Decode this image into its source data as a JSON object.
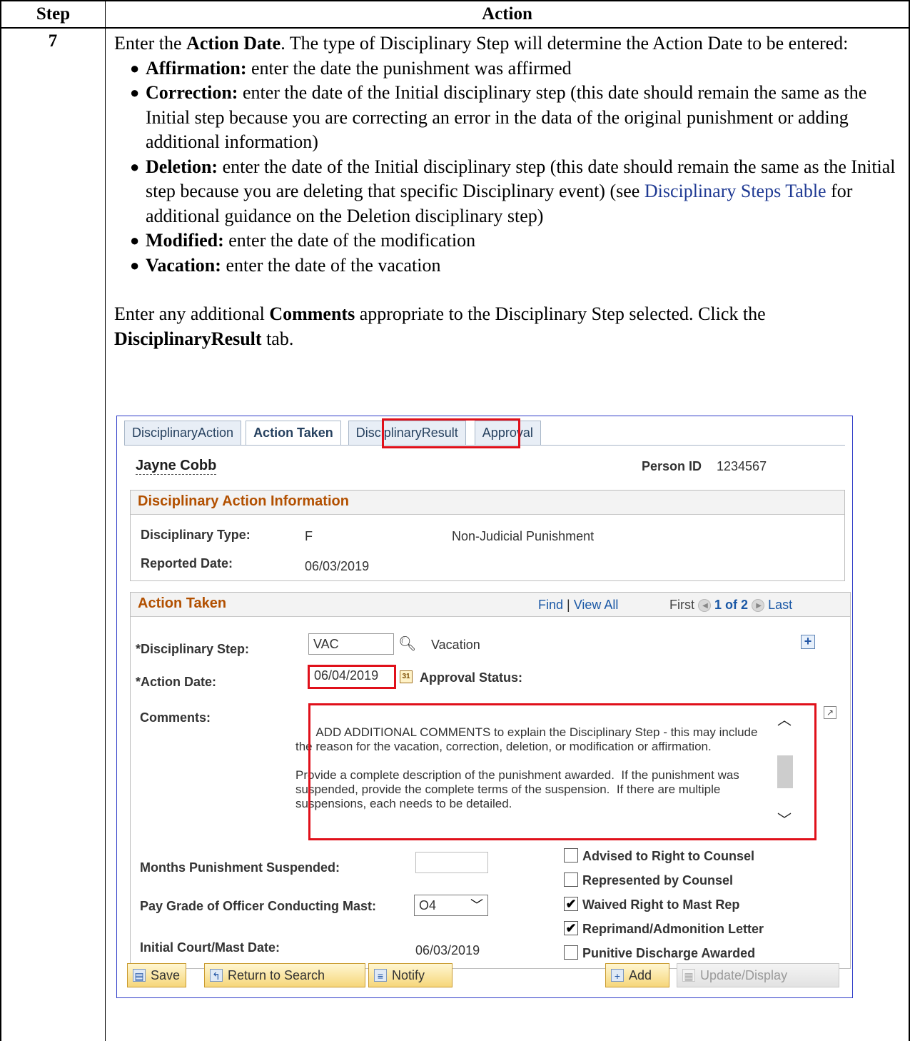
{
  "doc": {
    "header_step": "Step",
    "header_action": "Action",
    "step_number": "7",
    "intro_bold": "Action Date",
    "intro_pre": "Enter the ",
    "intro_post": ".  The type of Disciplinary Step will determine the Action Date to be entered:",
    "bullets": [
      {
        "term": "Affirmation:",
        "text": "  enter the date the punishment was affirmed"
      },
      {
        "term": "Correction:",
        "text": "  enter the date of the Initial disciplinary step (this date should remain the same as the Initial step because you are correcting an error in the data of the original punishment or adding additional information)"
      },
      {
        "term": "Deletion:",
        "text_pre": "  enter the date of the Initial disciplinary step (this date should remain the same as the Initial step because you are deleting that specific Disciplinary event) (see ",
        "link": "Disciplinary Steps Table",
        "text_post": " for additional guidance on the Deletion disciplinary step)"
      },
      {
        "term": "Modified:",
        "text": "  enter the date of the modification"
      },
      {
        "term": "Vacation:",
        "text": "  enter the date of the vacation"
      }
    ],
    "comments_pre": "Enter any additional ",
    "comments_bold": "Comments",
    "comments_post": " appropriate to the Disciplinary Step selected.  Click the ",
    "click_bold": "DisciplinaryResult",
    "click_post": " tab."
  },
  "ps": {
    "tabs": [
      "DisciplinaryAction",
      "Action Taken",
      "DisciplinaryResult",
      "Approval"
    ],
    "name": "Jayne Cobb",
    "person_id_label": "Person ID",
    "person_id": "1234567",
    "info_section": {
      "title": "Disciplinary Action Information",
      "type_label": "Disciplinary Type:",
      "type_code": "F",
      "type_desc": "Non-Judicial Punishment",
      "reported_label": "Reported Date:",
      "reported_date": "06/03/2019"
    },
    "action_section": {
      "title": "Action Taken",
      "find": "Find",
      "view_all": "View All",
      "first": "First",
      "count": "1 of 2",
      "last": "Last",
      "step_label": "*Disciplinary Step:",
      "step_value": "VAC",
      "step_desc": "Vacation",
      "date_label": "*Action Date:",
      "date_value": "06/04/2019",
      "approval_label": "Approval Status:",
      "comments_label": "Comments:",
      "comments_text": "ADD ADDITIONAL COMMENTS to explain the Disciplinary Step - this may include the reason for the vacation, correction, deletion, or modification or affirmation.\n\nProvide a complete description of the punishment awarded.  If the punishment was suspended, provide the complete terms of the suspension.  If there are multiple suspensions, each needs to be detailed.",
      "months_label": "Months Punishment Suspended:",
      "months_value": "",
      "paygrade_label": "Pay Grade of Officer Conducting Mast:",
      "paygrade_value": "O4",
      "initial_label": "Initial Court/Mast Date:",
      "initial_value": "06/03/2019",
      "checkboxes": [
        {
          "label": "Advised to Right to Counsel",
          "checked": false
        },
        {
          "label": "Represented by Counsel",
          "checked": false
        },
        {
          "label": "Waived Right to Mast Rep",
          "checked": true
        },
        {
          "label": "Reprimand/Admonition Letter",
          "checked": true
        },
        {
          "label": "Punitive Discharge Awarded",
          "checked": false
        }
      ]
    },
    "buttons": {
      "save": "Save",
      "return": "Return to Search",
      "notify": "Notify",
      "add": "Add",
      "update": "Update/Display"
    }
  },
  "colors": {
    "highlight": "#e0101a",
    "section_title": "#b25000",
    "link": "#1a58a6"
  }
}
